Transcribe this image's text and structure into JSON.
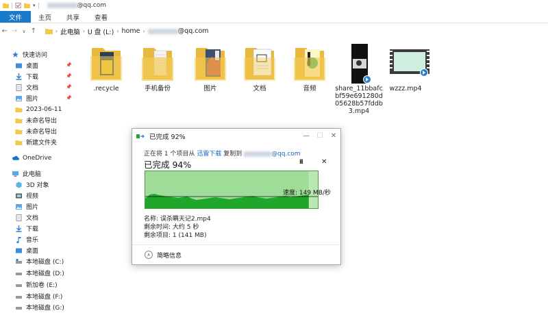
{
  "window": {
    "title_suffix": "@qq.com"
  },
  "ribbon": {
    "tabs": [
      "文件",
      "主页",
      "共享",
      "查看"
    ]
  },
  "address": {
    "crumbs": [
      "此电脑",
      "U 盘 (L:)",
      "home"
    ],
    "last_suffix": "@qq.com"
  },
  "sidebar": {
    "items": [
      "快速访问",
      "桌面",
      "下载",
      "文档",
      "图片",
      "2023-06-11",
      "未命名导出",
      "未命名导出",
      "新建文件夹",
      "OneDrive",
      "此电脑",
      "3D 对象",
      "视频",
      "图片",
      "文档",
      "下载",
      "音乐",
      "桌面",
      "本地磁盘 (C:)",
      "本地磁盘 (D:)",
      "新加卷 (E:)",
      "本地磁盘 (F:)",
      "本地磁盘 (G:)"
    ]
  },
  "files": [
    {
      "name": ".recycle",
      "icon": "folder-icon"
    },
    {
      "name": "手机备份",
      "icon": "folder-icon"
    },
    {
      "name": "图片",
      "icon": "folder-icon"
    },
    {
      "name": "文档",
      "icon": "folder-icon"
    },
    {
      "name": "音频",
      "icon": "folder-icon"
    },
    {
      "name": "share_11bbafcbf59e691280d05628b57fddb3.mp4",
      "icon": "video-thumbnail"
    },
    {
      "name": "wzzz.mp4",
      "icon": "video-thumbnail"
    }
  ],
  "dialog": {
    "title": "已完成 92%",
    "from_prefix": "正在将 1 个项目从 ",
    "from_source": "迅雷下载",
    "from_mid": " 复制到 ",
    "from_dest_suffix": "@qq.com",
    "percent_label": "已完成 94%",
    "progress": 94,
    "speed_label": "速度: 149 MB/秒",
    "name_label": "名称: 误杀瞒天记2.mp4",
    "time_label": "剩余时间: 大约 5 秒",
    "items_label": "剩余项目: 1 (141 MB)",
    "details_label": "简略信息",
    "pause_glyph": "II",
    "close_glyph": "✕"
  },
  "colors": {
    "accent": "#1979ca",
    "graph_fill": "#1fa72c",
    "graph_bg": "#b9e8b3",
    "folder": "#f3c94b"
  }
}
